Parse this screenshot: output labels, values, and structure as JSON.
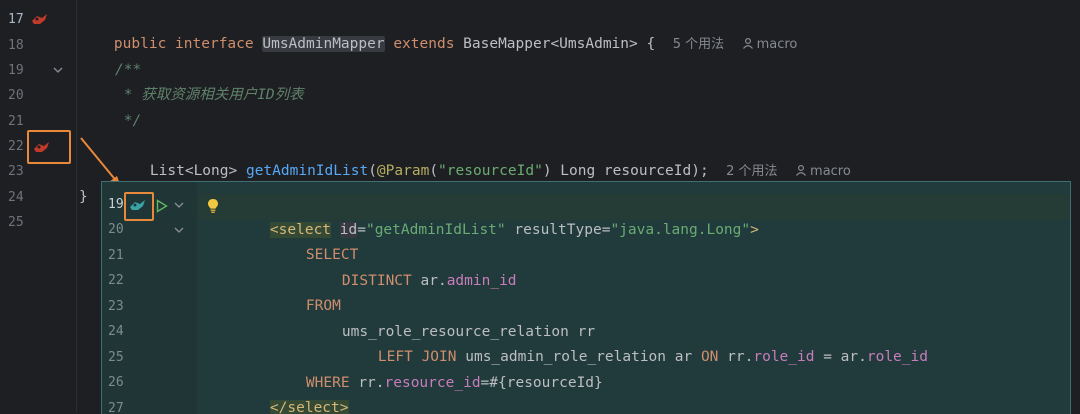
{
  "editor": {
    "lines": [
      {
        "num": "17",
        "current": true
      },
      {
        "num": "18"
      },
      {
        "num": "19"
      },
      {
        "num": "20"
      },
      {
        "num": "21"
      },
      {
        "num": "22"
      },
      {
        "num": "23"
      },
      {
        "num": "24"
      },
      {
        "num": "25"
      }
    ],
    "code": {
      "l17_kw1": "public",
      "l17_kw2": "interface",
      "l17_name": "UmsAdminMapper",
      "l17_kw3": "extends",
      "l17_rest": "BaseMapper<UmsAdmin> {",
      "l17_usages": "5 个用法",
      "l17_author": "macro",
      "l19_doc": "/**",
      "l20_doc": " * 获取资源相关用户ID列表",
      "l21_doc": " */",
      "l22_type": "List<Long>",
      "l22_method": "getAdminIdList",
      "l22_open": "(",
      "l22_ann": "@Param",
      "l22_ann_open": "(",
      "l22_str": "\"resourceId\"",
      "l22_rest": ") Long resourceId);",
      "l22_usages": "2 个用法",
      "l22_author": "macro",
      "l24_brace": "}"
    }
  },
  "popup": {
    "lines": [
      {
        "num": "19",
        "current": true
      },
      {
        "num": "20"
      },
      {
        "num": "21"
      },
      {
        "num": "22"
      },
      {
        "num": "23"
      },
      {
        "num": "24"
      },
      {
        "num": "25"
      },
      {
        "num": "26"
      },
      {
        "num": "27"
      }
    ],
    "code": {
      "p19_tag": "<select",
      "p19_attr1": "id",
      "p19_eq1": "=",
      "p19_val1": "\"getAdminIdList\"",
      "p19_attr2": "resultType",
      "p19_eq2": "=",
      "p19_val2": "\"java.lang.Long\"",
      "p19_close": ">",
      "p20": "SELECT",
      "p21_kw": "DISTINCT",
      "p21_tbl": "ar.",
      "p21_col": "admin_id",
      "p22": "FROM",
      "p23": "ums_role_resource_relation rr",
      "p24_kw1": "LEFT JOIN",
      "p24_tbl": "ums_admin_role_relation ar",
      "p24_kw2": "ON",
      "p24_a": "rr.",
      "p24_c1": "role_id",
      "p24_eq": " = ar.",
      "p24_c2": "role_id",
      "p25_kw": "WHERE",
      "p25_a": "rr.",
      "p25_col": "resource_id",
      "p25_rest": "=#{resourceId}",
      "p26_tag": "</select>"
    }
  },
  "colors": {
    "highlight": "#e8883a",
    "popup_bg": "#213a3b",
    "keyword": "#cf8e6d",
    "function": "#56a8f5",
    "string": "#6aab73"
  }
}
